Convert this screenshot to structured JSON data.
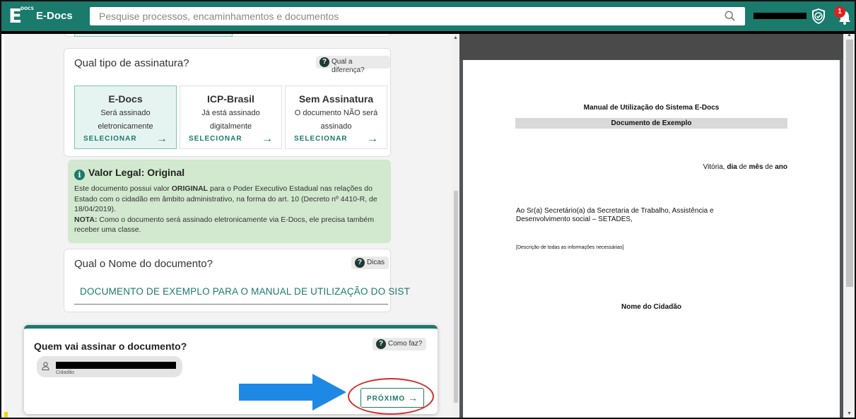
{
  "header": {
    "logo_letter": "E",
    "logo_small": "DOCS",
    "app_title": "E-Docs",
    "search_placeholder": "Pesquise processos, encaminhamentos e documentos",
    "notification_count": "1"
  },
  "signature_type": {
    "question": "Qual tipo de assinatura?",
    "help_label": "Qual a diferença?",
    "options": [
      {
        "title": "E-Docs",
        "line1": "Será assinado",
        "line2": "eletronicamente",
        "select_label": "SELECIONAR"
      },
      {
        "title": "ICP-Brasil",
        "line1": "Já está assinado",
        "line2": "digitalmente",
        "select_label": "SELECIONAR"
      },
      {
        "title": "Sem Assinatura",
        "line1": "O documento NÃO será",
        "line2": "assinado",
        "select_label": "SELECIONAR"
      }
    ]
  },
  "legal": {
    "title": "Valor Legal: Original",
    "p1_a": "Este documento possui valor ",
    "p1_strong": "ORIGINAL",
    "p1_b": " para o Poder Executivo Estadual nas relações do Estado com o cidadão em âmbito administrativo, na forma do art. 10 (Decreto nº 4410-R, de 18/04/2019).",
    "note_label": "NOTA:",
    "note_text": " Como o documento será assinado eletronicamente via E-Docs, ele precisa também receber uma classe."
  },
  "doc_name": {
    "question": "Qual o Nome do documento?",
    "help_label": "Dicas",
    "value": "DOCUMENTO DE EXEMPLO PARA O MANUAL DE UTILIZAÇÃO DO SIST"
  },
  "signer": {
    "question": "Quem vai assinar o documento?",
    "help_label": "Como faz?",
    "role": "Cidadão",
    "next_label": "PRÓXIMO",
    "next_arrow": "→"
  },
  "preview": {
    "title": "Manual de Utilização do Sistema E-Docs",
    "subtitle": "Documento de Exemplo",
    "date_city": "Vitória, ",
    "date_dia": "dia",
    "date_de1": " de ",
    "date_mes": "mês",
    "date_de2": " de ",
    "date_ano": "ano",
    "addressee": "Ao Sr(a) Secretário(a) da Secretaria de Trabalho, Assistência e Desenvolvimento social – SETADES,",
    "description": "[Descrição de todas as informações necessárias]",
    "signature_name": "Nome do Cidadão"
  },
  "colors": {
    "brand": "#1a7a6c",
    "legal_bg": "#d2e8cf",
    "highlight": "#d32f2f",
    "pointer_arrow": "#1e88e5"
  }
}
